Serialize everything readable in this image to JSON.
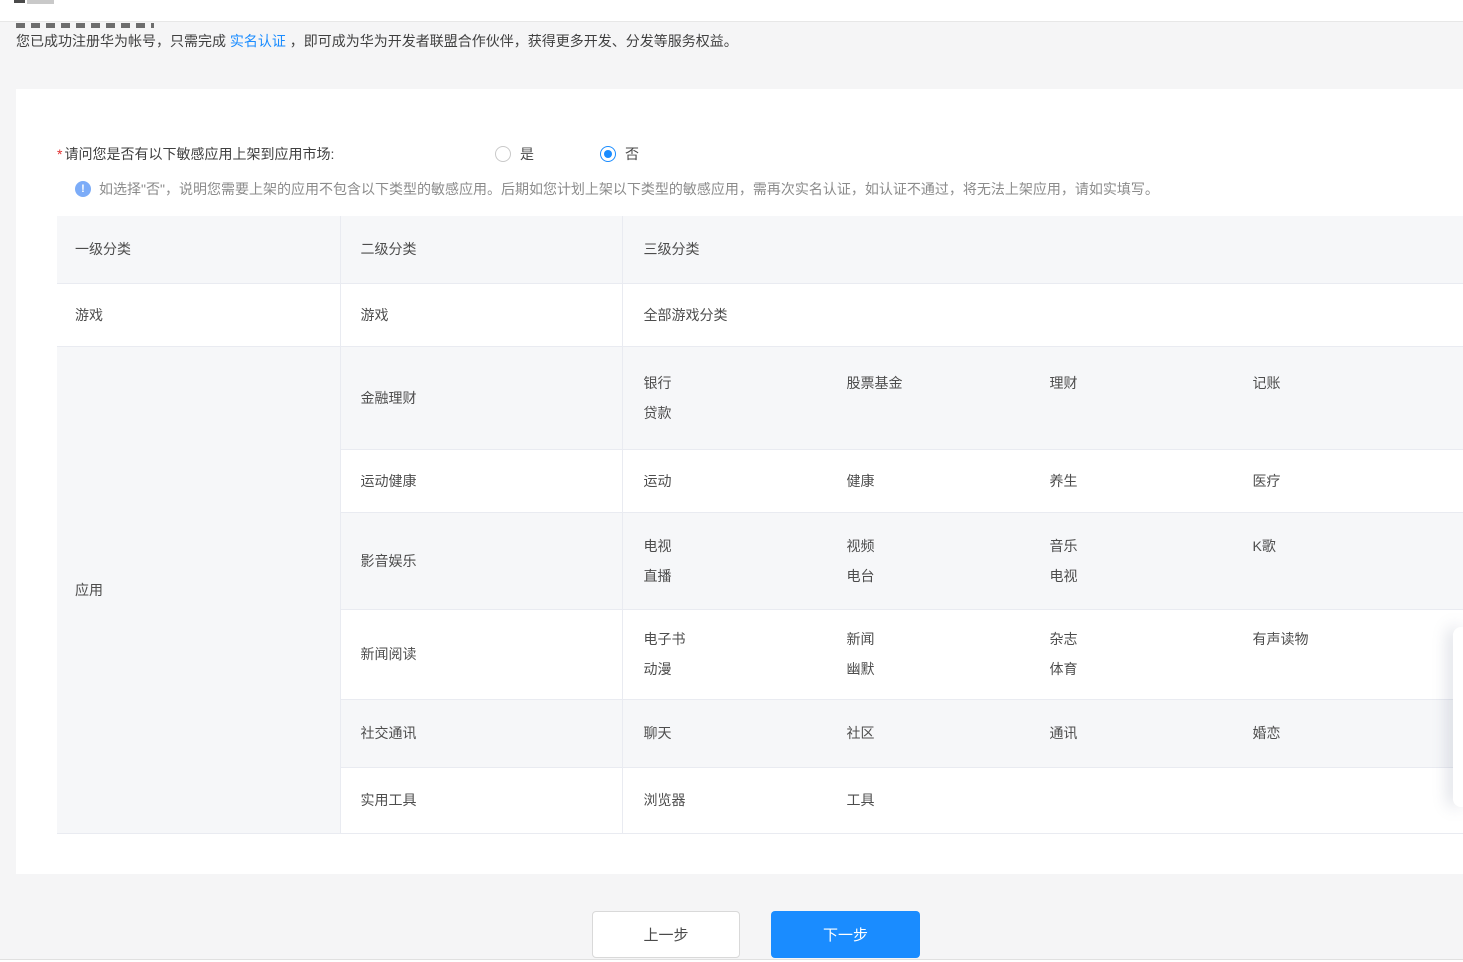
{
  "intro": {
    "prefix": "您已成功注册华为帐号，只需完成 ",
    "link": "实名认证",
    "suffix": " ，即可成为华为开发者联盟合作伙伴，获得更多开发、分发等服务权益。"
  },
  "form": {
    "required": "*",
    "question": "请问您是否有以下敏感应用上架到应用市场:",
    "options": [
      {
        "label": "是",
        "selected": false
      },
      {
        "label": "否",
        "selected": true
      }
    ],
    "note": "如选择\"否\"，说明您需要上架的应用不包含以下类型的敏感应用。后期如您计划上架以下类型的敏感应用，需再次实名认证，如认证不通过，将无法上架应用，请如实填写。"
  },
  "icons": {
    "info_glyph": "!"
  },
  "table": {
    "headers": [
      "一级分类",
      "二级分类",
      "三级分类"
    ],
    "game_row": {
      "level1": "游戏",
      "level2": "游戏",
      "level3": "全部游戏分类"
    },
    "app_label": "应用",
    "app_rows": [
      {
        "level2": "金融理财",
        "items": [
          [
            "银行",
            "贷款"
          ],
          [
            "股票基金"
          ],
          [
            "理财"
          ],
          [
            "记账"
          ]
        ]
      },
      {
        "level2": "运动健康",
        "items": [
          [
            "运动"
          ],
          [
            "健康"
          ],
          [
            "养生"
          ],
          [
            "医疗"
          ]
        ]
      },
      {
        "level2": "影音娱乐",
        "items": [
          [
            "电视",
            "直播"
          ],
          [
            "视频",
            "电台"
          ],
          [
            "音乐",
            "电视"
          ],
          [
            "K歌"
          ]
        ]
      },
      {
        "level2": "新闻阅读",
        "items": [
          [
            "电子书",
            "动漫"
          ],
          [
            "新闻",
            "幽默"
          ],
          [
            "杂志",
            "体育"
          ],
          [
            "有声读物"
          ]
        ]
      },
      {
        "level2": "社交通讯",
        "items": [
          [
            "聊天"
          ],
          [
            "社区"
          ],
          [
            "通讯"
          ],
          [
            "婚恋"
          ]
        ]
      },
      {
        "level2": "实用工具",
        "items": [
          [
            "浏览器"
          ],
          [
            "工具"
          ]
        ]
      }
    ]
  },
  "buttons": {
    "prev": "上一步",
    "next": "下一步"
  },
  "colors": {
    "accent_blue": "#1a8cff",
    "link_blue": "#1a8cff",
    "required_red": "#e02e2e",
    "info_icon_blue": "#7cacf8",
    "page_gray": "#f5f5f6",
    "stripe_gray": "#f6f7f9",
    "table_border": "#e9ebf1"
  }
}
